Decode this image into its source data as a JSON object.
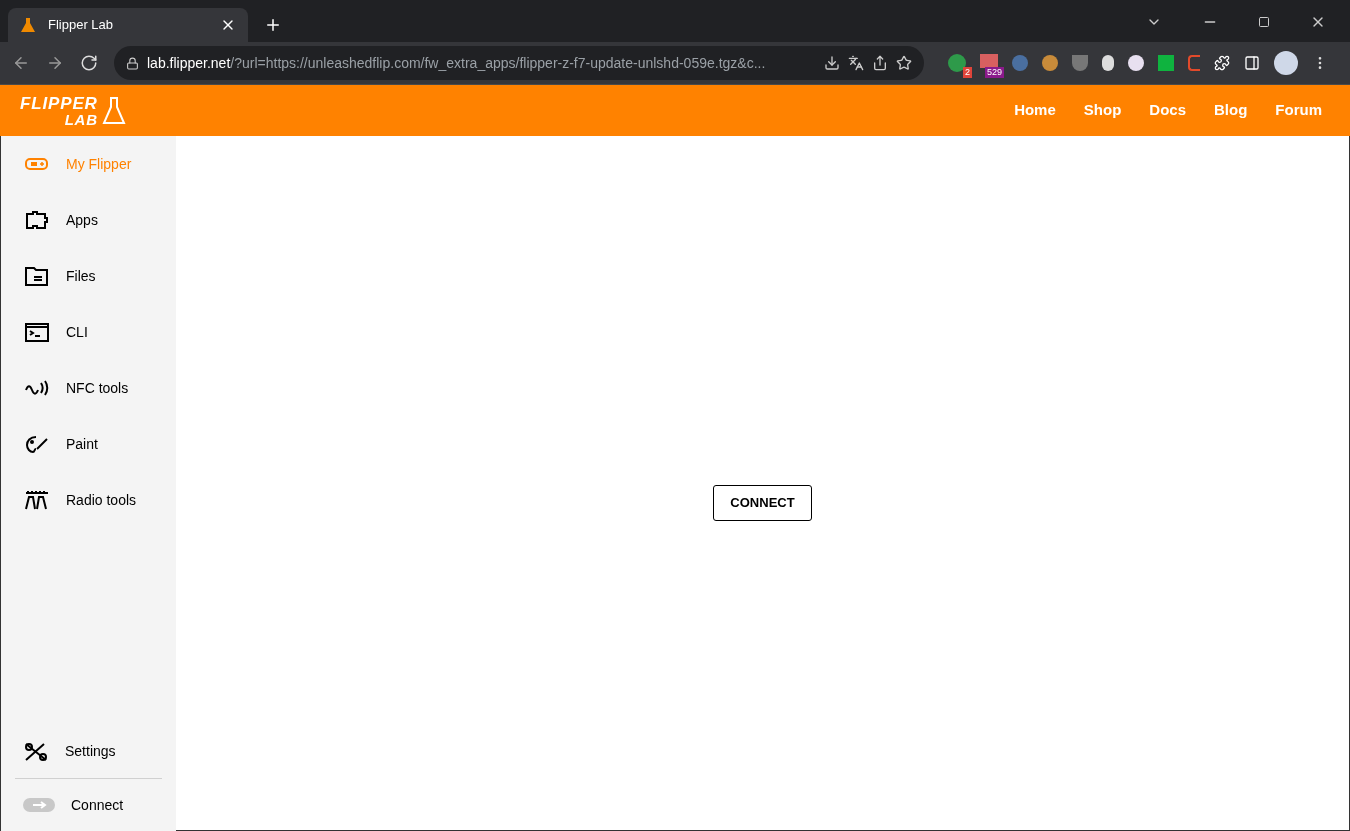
{
  "browser": {
    "tab": {
      "title": "Flipper Lab"
    },
    "url": {
      "host": "lab.flipper.net",
      "rest": "/?url=https://unleashedflip.com/fw_extra_apps/flipper-z-f7-update-unlshd-059e.tgz&c..."
    },
    "extension_badges": [
      {
        "text": "2",
        "color": "#e0443a"
      },
      {
        "text": "529",
        "color": "#8b1a8b"
      }
    ]
  },
  "header": {
    "logo": {
      "line1": "FLIPPER",
      "line2": "LAB"
    },
    "nav": [
      "Home",
      "Shop",
      "Docs",
      "Blog",
      "Forum"
    ]
  },
  "sidebar": {
    "items": [
      {
        "kind": "device",
        "label": "My Flipper",
        "selected": true
      },
      {
        "kind": "apps",
        "label": "Apps",
        "selected": false
      },
      {
        "kind": "files",
        "label": "Files",
        "selected": false
      },
      {
        "kind": "cli",
        "label": "CLI",
        "selected": false
      },
      {
        "kind": "nfc",
        "label": "NFC tools",
        "selected": false
      },
      {
        "kind": "paint",
        "label": "Paint",
        "selected": false
      },
      {
        "kind": "radio",
        "label": "Radio tools",
        "selected": false
      }
    ],
    "bottom": [
      {
        "kind": "settings",
        "label": "Settings"
      },
      {
        "kind": "connect",
        "label": "Connect"
      }
    ]
  },
  "main": {
    "button": "CONNECT"
  }
}
